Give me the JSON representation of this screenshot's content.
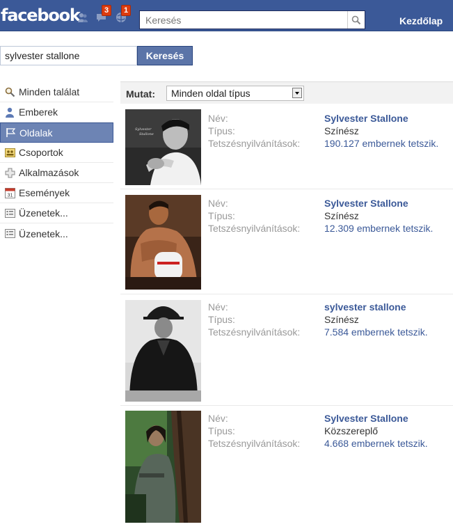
{
  "header": {
    "logo": "facebook",
    "badges": {
      "messages": "3",
      "notifications": "1"
    },
    "search_placeholder": "Keresés",
    "home_label": "Kezdőlap",
    "accent_color": "#3b5998"
  },
  "search": {
    "query": "sylvester stallone",
    "button_label": "Keresés"
  },
  "sidebar": {
    "items": [
      {
        "label": "Minden találat",
        "icon": "magnifier-icon"
      },
      {
        "label": "Emberek",
        "icon": "person-icon"
      },
      {
        "label": "Oldalak",
        "icon": "page-flag-icon",
        "selected": true
      },
      {
        "label": "Csoportok",
        "icon": "group-icon"
      },
      {
        "label": "Alkalmazások",
        "icon": "puzzle-icon"
      },
      {
        "label": "Események",
        "icon": "calendar-icon",
        "calendar_day": "31"
      },
      {
        "label": "Üzenetek...",
        "icon": "message-icon"
      },
      {
        "label": "Üzenetek...",
        "icon": "message-icon"
      }
    ]
  },
  "filter": {
    "label": "Mutat:",
    "selected": "Minden oldal típus"
  },
  "field_labels": {
    "name": "Név:",
    "type": "Típus:",
    "likes": "Tetszésnyilvánítások:"
  },
  "results": [
    {
      "name": "Sylvester Stallone",
      "type": "Színész",
      "likes": "190.127 embernek tetszik."
    },
    {
      "name": "Sylvester Stallone",
      "type": "Színész",
      "likes": "12.309 embernek tetszik."
    },
    {
      "name": "sylvester stallone",
      "type": "Színész",
      "likes": "7.584 embernek tetszik."
    },
    {
      "name": "Sylvester Stallone",
      "type": "Közszereplő",
      "likes": "4.668 embernek tetszik."
    }
  ]
}
